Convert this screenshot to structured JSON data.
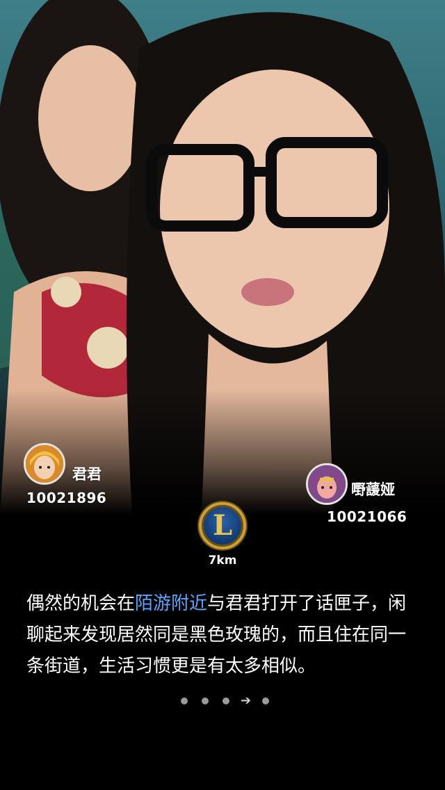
{
  "users": [
    {
      "name": "君君",
      "id": "10021896",
      "avatar_color": "#d98a2b"
    },
    {
      "name": "嘢蘐娅",
      "id": "10021066",
      "avatar_color": "#7e4a8a"
    }
  ],
  "center": {
    "icon": "league-emblem-icon",
    "letter": "L",
    "distance": "7km"
  },
  "story": {
    "before": "偶然的机会在",
    "highlight": "陌游附近",
    "after": "与君君打开了话匣子，闲聊起来发现居然同是黑色玫瑰的，而且住在同一条街道，生活习惯更是有太多相似。",
    "highlight_color": "#5aa6ff"
  },
  "pager": {
    "total": 5,
    "current": 4
  }
}
